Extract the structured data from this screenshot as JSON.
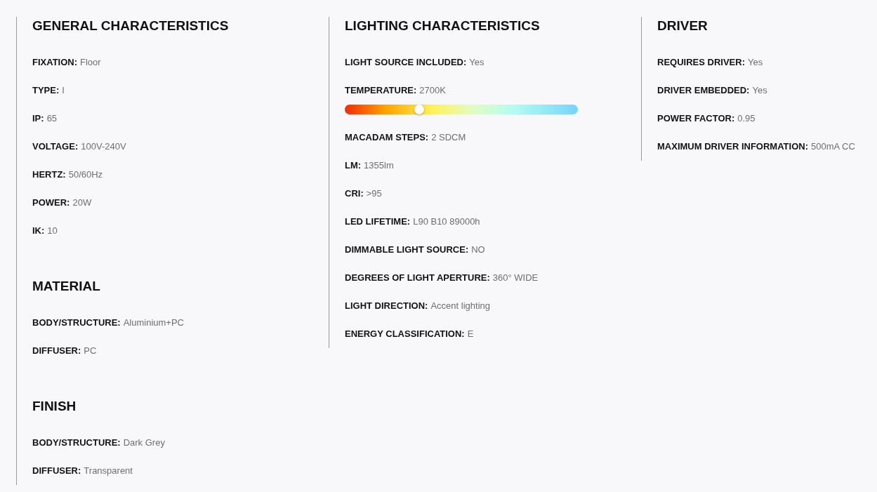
{
  "columns": [
    {
      "sections": [
        {
          "heading": "GENERAL CHARACTERISTICS",
          "items": [
            {
              "kind": "text",
              "label": "FIXATION:",
              "value": "Floor"
            },
            {
              "kind": "text",
              "label": "TYPE:",
              "value": "I"
            },
            {
              "kind": "text",
              "label": "IP:",
              "value": "65"
            },
            {
              "kind": "text",
              "label": "VOLTAGE:",
              "value": "100V-240V"
            },
            {
              "kind": "text",
              "label": "HERTZ:",
              "value": "50/60Hz"
            },
            {
              "kind": "text",
              "label": "POWER:",
              "value": "20W"
            },
            {
              "kind": "text",
              "label": "IK:",
              "value": "10"
            }
          ]
        },
        {
          "heading": "MATERIAL",
          "items": [
            {
              "kind": "text",
              "label": "BODY/STRUCTURE:",
              "value": "Aluminium+PC"
            },
            {
              "kind": "text",
              "label": "DIFFUSER:",
              "value": "PC"
            }
          ]
        },
        {
          "heading": "FINISH",
          "items": [
            {
              "kind": "text",
              "label": "BODY/STRUCTURE:",
              "value": "Dark Grey"
            },
            {
              "kind": "text",
              "label": "DIFFUSER:",
              "value": "Transparent"
            }
          ]
        }
      ]
    },
    {
      "sections": [
        {
          "heading": "LIGHTING CHARACTERISTICS",
          "items": [
            {
              "kind": "text",
              "label": "LIGHT SOURCE INCLUDED:",
              "value": "Yes"
            },
            {
              "kind": "scale",
              "label": "TEMPERATURE:",
              "value": "2700K",
              "level": 0.32
            },
            {
              "kind": "text",
              "label": "MACADAM STEPS:",
              "value": "2 SDCM"
            },
            {
              "kind": "text",
              "label": "LM:",
              "value": "1355lm"
            },
            {
              "kind": "text",
              "label": "CRI:",
              "value": ">95"
            },
            {
              "kind": "text",
              "label": "LED LIFETIME:",
              "value": "L90 B10 89000h"
            },
            {
              "kind": "text",
              "label": "DIMMABLE LIGHT SOURCE:",
              "value": "NO"
            },
            {
              "kind": "text",
              "label": "DEGREES OF LIGHT APERTURE:",
              "value": "360° WIDE"
            },
            {
              "kind": "text",
              "label": "LIGHT DIRECTION:",
              "value": "Accent lighting"
            },
            {
              "kind": "text",
              "label": "ENERGY CLASSIFICATION:",
              "value": "E"
            }
          ]
        }
      ]
    },
    {
      "sections": [
        {
          "heading": "DRIVER",
          "items": [
            {
              "kind": "text",
              "label": "REQUIRES DRIVER:",
              "value": "Yes"
            },
            {
              "kind": "text",
              "label": "DRIVER EMBEDDED:",
              "value": "Yes"
            },
            {
              "kind": "text",
              "label": "POWER FACTOR:",
              "value": "0.95"
            },
            {
              "kind": "text",
              "label": "MAXIMUM DRIVER INFORMATION:",
              "value": "500mA CC"
            }
          ]
        }
      ]
    }
  ]
}
